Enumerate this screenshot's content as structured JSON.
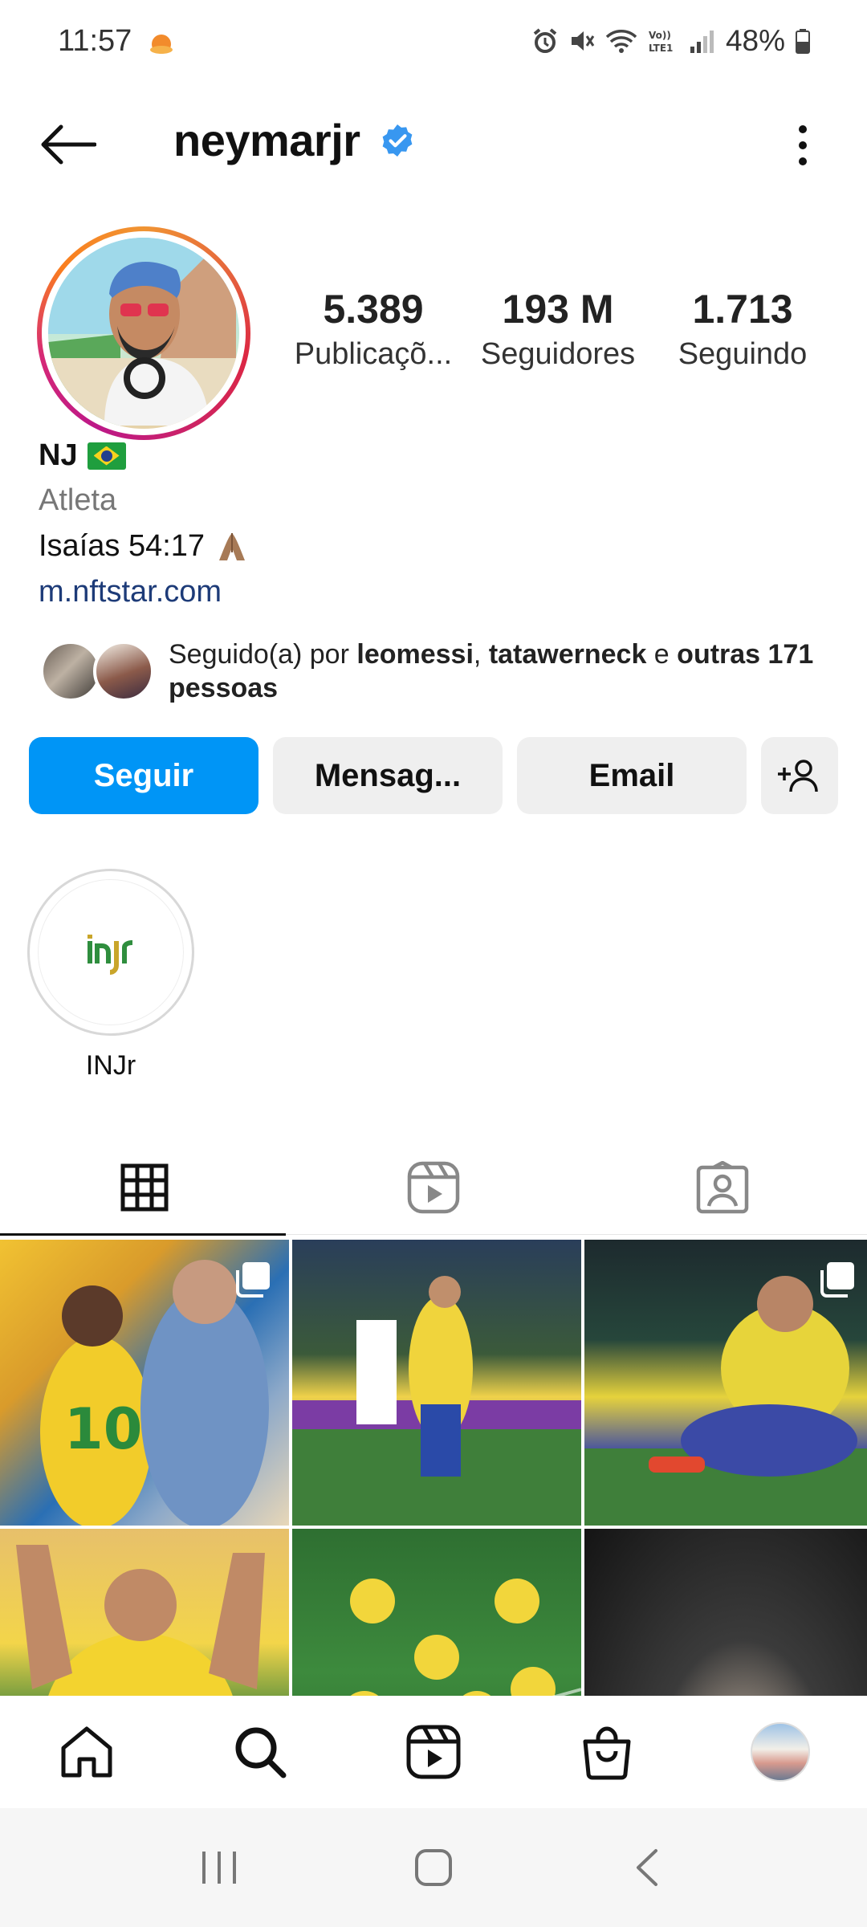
{
  "status_bar": {
    "time": "11:57",
    "battery": "48%"
  },
  "header": {
    "username": "neymarjr"
  },
  "stats": [
    {
      "value": "5.389",
      "label": "Publicaçõ..."
    },
    {
      "value": "193 M",
      "label": "Seguidores"
    },
    {
      "value": "1.713",
      "label": "Seguindo"
    }
  ],
  "profile": {
    "name": "NJ",
    "category": "Atleta",
    "bio": "Isaías 54:17",
    "link": "m.nftstar.com"
  },
  "followed_by": {
    "prefix": "Seguido(a) por ",
    "user1": "leomessi",
    "sep": ", ",
    "user2": "tatawerneck",
    "and": " e ",
    "others": "outras 171 pessoas"
  },
  "actions": {
    "follow": "Seguir",
    "message": "Mensag...",
    "email": "Email"
  },
  "highlights": [
    {
      "label": "INJr"
    }
  ],
  "colors": {
    "accent": "#0095f6",
    "verified": "#3897f0"
  }
}
